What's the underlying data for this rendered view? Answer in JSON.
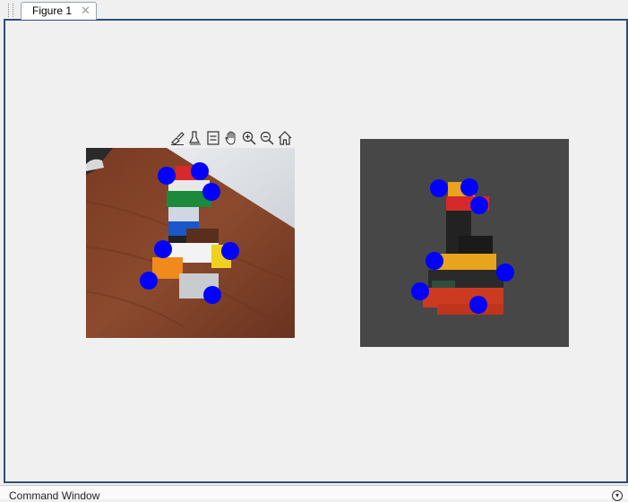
{
  "tab": {
    "label": "Figure 1",
    "close_glyph": "✕"
  },
  "axes_toolbar": {
    "icons": [
      "brush-icon",
      "data-tips-icon",
      "legend-icon",
      "pan-icon",
      "zoom-in-icon",
      "zoom-out-icon",
      "home-icon"
    ]
  },
  "images": {
    "left": {
      "name": "lego-photo-with-keypoints",
      "keypoint_color": "#0000ff"
    },
    "right": {
      "name": "lego-render-with-keypoints",
      "background": "#474747",
      "keypoint_color": "#0000ff"
    }
  },
  "command_window": {
    "title": "Command Window",
    "menu_glyph": "▾"
  },
  "colors": {
    "panel_border": "#2f4f78",
    "background": "#f0f0f0"
  }
}
